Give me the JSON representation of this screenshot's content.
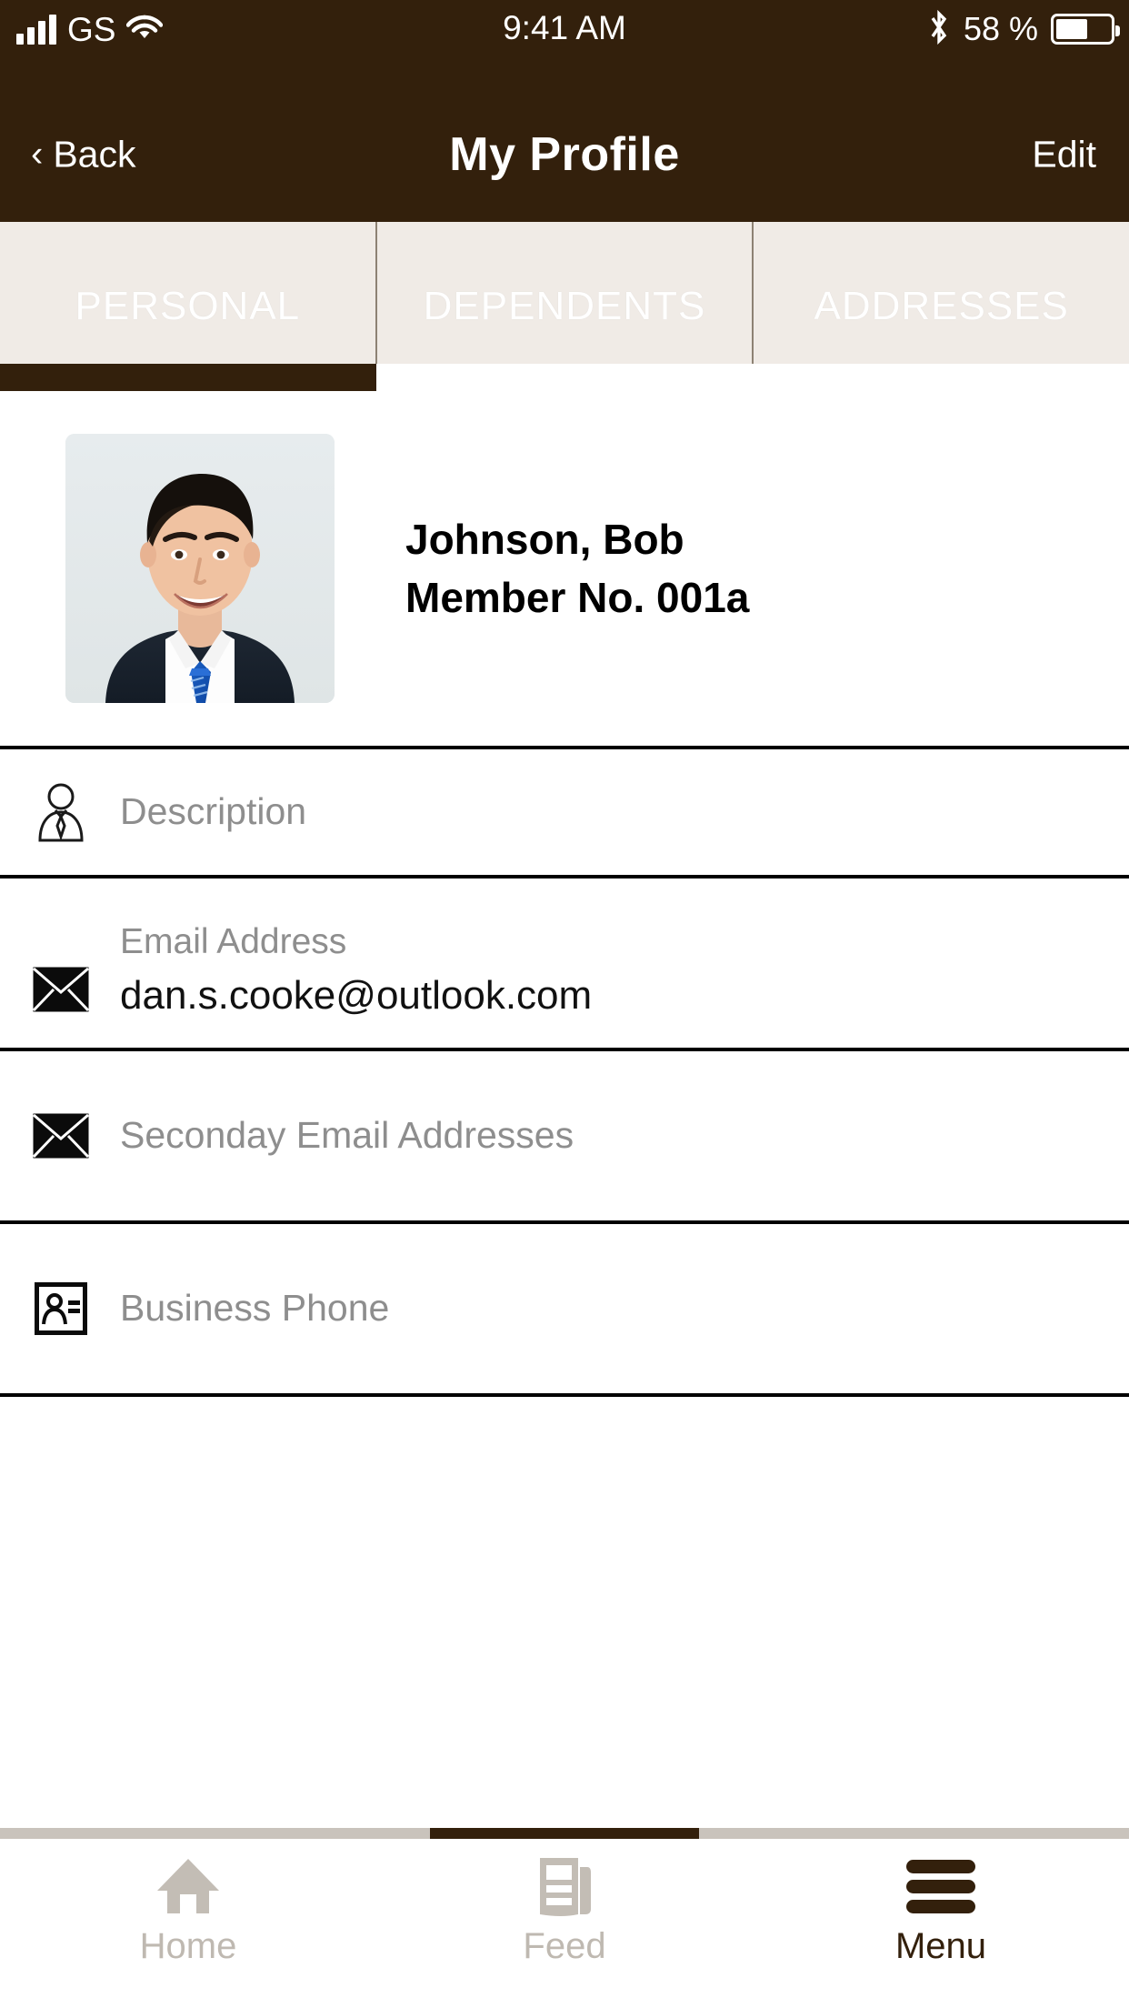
{
  "colors": {
    "brand_brown": "#33200c",
    "tabbar_bg": "#f0ebe6",
    "placeholder_gray": "#8e8e8e",
    "inactive_gray": "#bfb9b1",
    "scroll_track": "#c9c3bc"
  },
  "status_bar": {
    "carrier": "GS",
    "time": "9:41 AM",
    "battery_percent": "58 %",
    "signal_icon": "signal-bars-icon",
    "wifi_icon": "wifi-icon",
    "bluetooth_icon": "bluetooth-icon",
    "battery_icon": "battery-icon"
  },
  "nav_bar": {
    "back_label": "Back",
    "back_chevron": "‹",
    "title": "My Profile",
    "edit_label": "Edit"
  },
  "tabs": [
    {
      "label": "PERSONAL",
      "active": true
    },
    {
      "label": "DEPENDENTS",
      "active": false
    },
    {
      "label": "ADDRESSES",
      "active": false
    }
  ],
  "profile": {
    "avatar_name": "profile-photo",
    "name": "Johnson, Bob",
    "member_no": "Member No. 001a"
  },
  "fields": [
    {
      "key": "description",
      "icon": "person-tie-icon",
      "label": "Description",
      "value": "",
      "is_placeholder": true
    },
    {
      "key": "email_address",
      "icon": "envelope-icon",
      "label": "Email Address",
      "value": "dan.s.cooke@outlook.com",
      "is_placeholder": false
    },
    {
      "key": "secondary_emails",
      "icon": "envelope-icon",
      "label": "Seconday Email Addresses",
      "value": "",
      "is_placeholder": true
    },
    {
      "key": "business_phone",
      "icon": "contact-card-icon",
      "label": "Business Phone",
      "value": "",
      "is_placeholder": true
    }
  ],
  "bottom_bar": [
    {
      "label": "Home",
      "icon": "home-icon",
      "active": false
    },
    {
      "label": "Feed",
      "icon": "newspaper-icon",
      "active": false
    },
    {
      "label": "Menu",
      "icon": "hamburger-icon",
      "active": true
    }
  ]
}
